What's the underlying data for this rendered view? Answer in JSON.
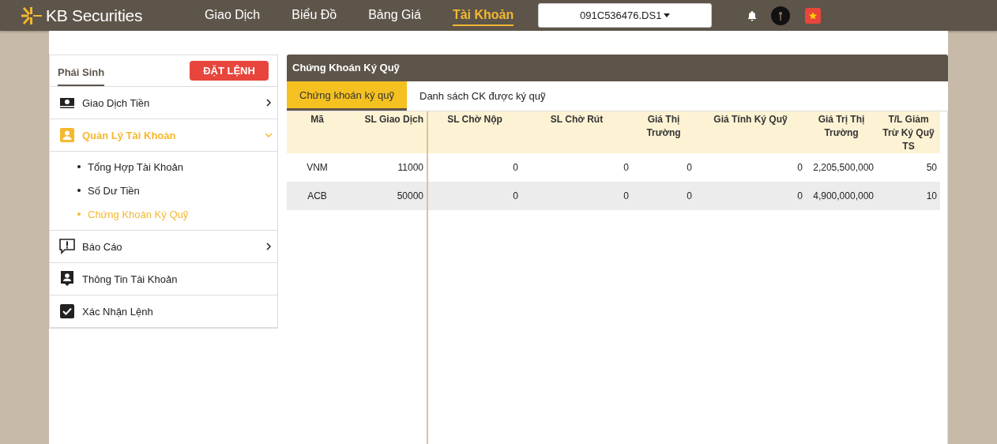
{
  "header": {
    "logo": "KB Securities",
    "nav": [
      {
        "label": "Giao Dịch",
        "selected": false
      },
      {
        "label": "Biểu Đồ",
        "selected": false
      },
      {
        "label": "Bảng Giá",
        "selected": false
      },
      {
        "label": "Tài Khoản",
        "selected": true
      }
    ],
    "account": "091C536476.DS1"
  },
  "sidebar": {
    "tab": "Phái Sinh",
    "order_button": "ĐẶT LỆNH",
    "items": [
      {
        "kind": "money",
        "label": "Giao Dịch Tiền",
        "expanded": false
      },
      {
        "kind": "profile",
        "label": "Quản Lý Tài Khoản",
        "expanded": true,
        "children": [
          {
            "label": "Tổng Hợp Tài Khoản",
            "selected": false
          },
          {
            "label": "Số Dư Tiền",
            "selected": false
          },
          {
            "label": "Chứng Khoán Ký Quỹ",
            "selected": true
          }
        ]
      },
      {
        "kind": "report",
        "label": "Báo Cáo",
        "expanded": false
      },
      {
        "kind": "account",
        "label": "Thông Tin Tài Khoản"
      },
      {
        "kind": "check",
        "label": "Xác Nhận Lệnh"
      }
    ]
  },
  "panel": {
    "title": "Chứng Khoán Ký Quỹ",
    "tabs": [
      {
        "label": "Chứng khoán ký quỹ",
        "selected": true
      },
      {
        "label": "Danh sách CK được ký quỹ",
        "selected": false
      }
    ],
    "table": {
      "columns": [
        "Mã",
        "SL Giao Dịch",
        "SL Chờ Nộp",
        "SL Chờ Rút",
        "Giá Thị Trường",
        "Giá Tính Ký Quỹ",
        "Giá Trị Thị Trường",
        "T/L Giảm Trừ Ký Quỹ TS"
      ],
      "rows": [
        [
          "VNM",
          "11000",
          "0",
          "0",
          "0",
          "0",
          "2,205,500,000",
          "50"
        ],
        [
          "ACB",
          "50000",
          "0",
          "0",
          "0",
          "0",
          "4,900,000,000",
          "10"
        ]
      ]
    }
  }
}
